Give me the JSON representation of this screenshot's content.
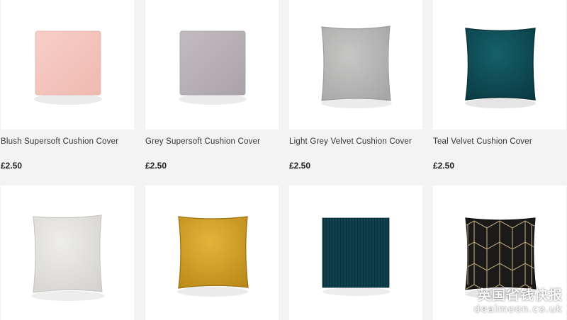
{
  "products": [
    {
      "title": "Blush Supersoft Cushion Cover",
      "price": "£2.50",
      "color": "#f5c7bf"
    },
    {
      "title": "Grey Supersoft Cushion Cover",
      "price": "£2.50",
      "color": "#b9b3b8"
    },
    {
      "title": "Light Grey Velvet Cushion Cover",
      "price": "£2.50",
      "color": "#b4b4b3"
    },
    {
      "title": "Teal Velvet Cushion Cover",
      "price": "£2.50",
      "color": "#0f4a52"
    },
    {
      "color": "#e2e0dd"
    },
    {
      "color": "#d6a42a"
    },
    {
      "color": "#0f3f4c"
    },
    {
      "color": "#1c1a18"
    }
  ],
  "watermark": {
    "cn": "英国省钱快报",
    "en": "dealmoon.co.uk"
  }
}
